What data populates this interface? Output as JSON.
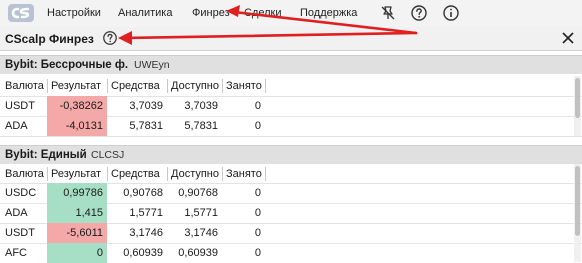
{
  "menu": {
    "items": [
      {
        "name": "menu-settings",
        "label": "Настройки"
      },
      {
        "name": "menu-analytics",
        "label": "Аналитика"
      },
      {
        "name": "menu-finrez",
        "label": "Финрез"
      },
      {
        "name": "menu-trades",
        "label": "Сделки"
      },
      {
        "name": "menu-support",
        "label": "Поддержка"
      }
    ],
    "icons": [
      "pin-off-icon",
      "help-icon",
      "info-icon"
    ]
  },
  "panel": {
    "title": "CScalp Финрез",
    "icons": [
      "help-icon",
      "close-icon"
    ]
  },
  "columns": [
    "Валюта",
    "Результат",
    "Средства",
    "Доступно",
    "Занято"
  ],
  "sections": [
    {
      "title": "Bybit: Бессрочные ф.",
      "account_id": "UWEyn",
      "rows": [
        {
          "currency": "USDT",
          "result": "-0,38262",
          "result_sign": "negative",
          "funds": "3,7039",
          "available": "3,7039",
          "busy": "0"
        },
        {
          "currency": "ADA",
          "result": "-4,0131",
          "result_sign": "negative",
          "funds": "5,7831",
          "available": "5,7831",
          "busy": "0"
        }
      ]
    },
    {
      "title": "Bybit: Единый",
      "account_id": "CLCSJ",
      "rows": [
        {
          "currency": "USDC",
          "result": "0,99786",
          "result_sign": "positive",
          "funds": "0,90768",
          "available": "0,90768",
          "busy": "0"
        },
        {
          "currency": "ADA",
          "result": "1,415",
          "result_sign": "positive",
          "funds": "1,5771",
          "available": "1,5771",
          "busy": "0"
        },
        {
          "currency": "USDT",
          "result": "-5,6011",
          "result_sign": "negative",
          "funds": "3,1746",
          "available": "3,1746",
          "busy": "0"
        },
        {
          "currency": "AFC",
          "result": "0",
          "result_sign": "positive",
          "funds": "0,60939",
          "available": "0,60939",
          "busy": "0"
        }
      ]
    }
  ],
  "colors": {
    "negative": "#f4a9a8",
    "positive": "#a7dfc6",
    "annotation_arrow": "#e02020"
  }
}
